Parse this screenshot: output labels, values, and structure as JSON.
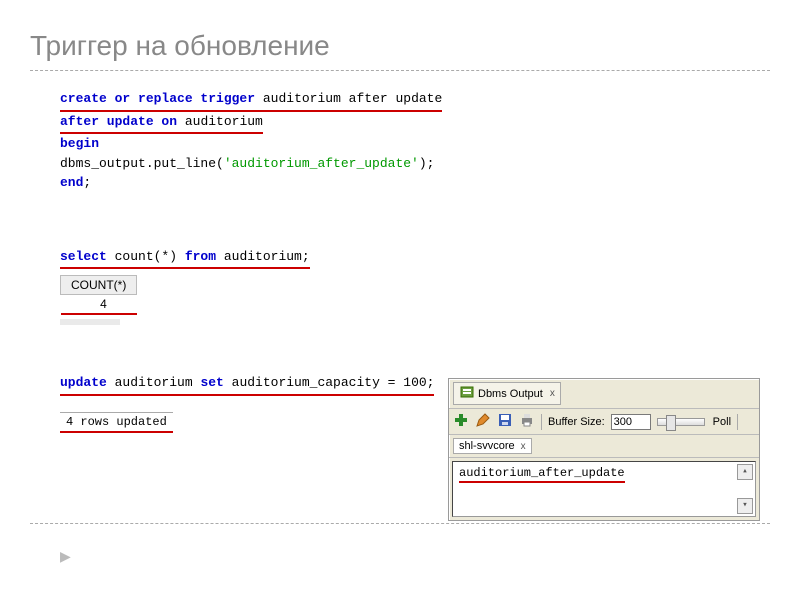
{
  "title": "Триггер на обновление",
  "code1": {
    "l1a": "create or replace trigger",
    "l1b": "auditorium after update",
    "l2a": "after update on",
    "l2b": "auditorium",
    "l3": "begin",
    "l4a": "  dbms_output.put_line(",
    "l4b": "'auditorium_after_update'",
    "l4c": ");",
    "l5": "end",
    "l5b": ";"
  },
  "code2": {
    "seg1": "select",
    "seg2": " count(*) ",
    "seg3": "from",
    "seg4": " auditorium;"
  },
  "result1": {
    "header": "COUNT(*)",
    "value": "4"
  },
  "code3": {
    "seg1": "update",
    "seg2": " auditorium ",
    "seg3": "set",
    "seg4": " auditorium_capacity = 100;"
  },
  "rows_updated": "4 rows updated",
  "dbms": {
    "title": "Dbms Output",
    "buffer_label": "Buffer Size:",
    "buffer_value": "300",
    "poll_label": "Poll",
    "subtab": "shl-svvcore",
    "output_line": "auditorium_after_update",
    "close_x": "x"
  }
}
